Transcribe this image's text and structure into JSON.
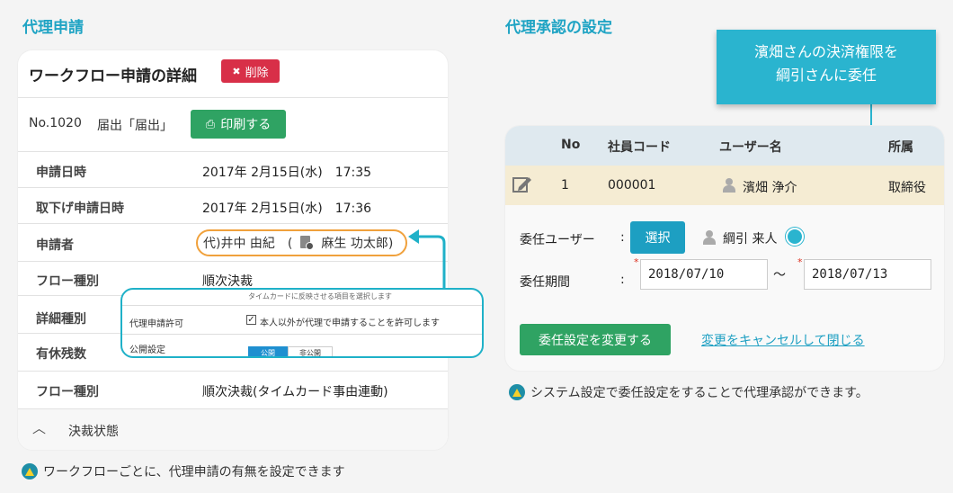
{
  "left": {
    "title": "代理申請",
    "card_title": "ワークフロー申請の詳細",
    "delete_label": "削除",
    "request_no": "No.1020",
    "request_type": "届出「届出」",
    "print_label": "印刷する",
    "rows": [
      {
        "label": "申請日時",
        "value": "2017年 2月15日(水)　17:35"
      },
      {
        "label": "取下げ申請日時",
        "value": "2017年 2月15日(水)　17:36"
      },
      {
        "label": "申請者",
        "value": "代)井中 由紀　(",
        "value2": "麻生 功太郎)"
      },
      {
        "label": "フロー種別",
        "value": "順次決裁"
      },
      {
        "label": "詳細種別",
        "value": ""
      },
      {
        "label": "有休残数",
        "value": ""
      },
      {
        "label": "フロー種別",
        "value": "順次決裁(タイムカード事由連動)"
      }
    ],
    "collapse_label": "決裁状態",
    "popup": {
      "top_text": "タイムカードに反映させる項目を選択します",
      "permit_label": "代理申請許可",
      "permit_checkbox": "本人以外が代理で申請することを許可します",
      "publish_label": "公開設定",
      "publish_on": "公開",
      "publish_off": "非公開"
    },
    "note": "ワークフローごとに、代理申請の有無を設定できます"
  },
  "right": {
    "title": "代理承認の設定",
    "callout": [
      "濱畑さんの決済権限を",
      "綱引さんに委任"
    ],
    "table": {
      "headers": [
        "No",
        "社員コード",
        "ユーザー名",
        "所属"
      ],
      "row": {
        "no": "1",
        "code": "000001",
        "name": "濱畑 浄介",
        "dept": "取締役"
      }
    },
    "delegate_label": "委任ユーザー",
    "colon": ":",
    "select_label": "選択",
    "delegate_user": "綱引 来人",
    "period_label": "委任期間",
    "date_from": "2018/07/10",
    "tilde": "～",
    "date_to": "2018/07/13",
    "required_mark": "*",
    "submit_label": "委任設定を変更する",
    "cancel_label": "変更をキャンセルして閉じる",
    "note": "システム設定で委任設定をすることで代理承認ができます。"
  },
  "colors": {
    "accent": "#20a4c4",
    "green": "#2fa363",
    "red": "#d82f48",
    "orange": "#f0a13c"
  }
}
